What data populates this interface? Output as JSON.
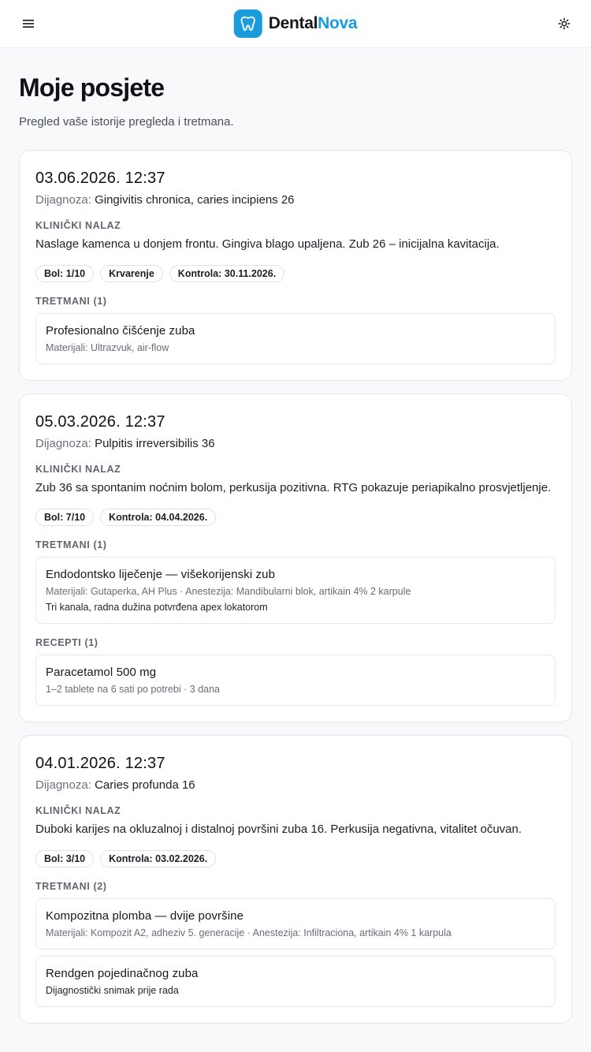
{
  "header": {
    "brand_part1": "Dental",
    "brand_part2": "Nova",
    "menu_icon": "menu-icon",
    "theme_icon": "sun-icon",
    "brand_color": "#1a9bdc"
  },
  "page": {
    "title": "Moje posjete",
    "subtitle": "Pregled vaše istorije pregleda i tretmana."
  },
  "labels": {
    "diagnosis": "Dijagnoza:",
    "finding": "KLINIČKI NALAZ"
  },
  "visits": [
    {
      "date": "03.06.2026. 12:37",
      "diagnosis": "Gingivitis chronica, caries incipiens 26",
      "finding": "Naslage kamenca u donjem frontu. Gingiva blago upaljena. Zub 26 – inicijalna kavitacija.",
      "badges": [
        "Bol: 1/10",
        "Krvarenje",
        "Kontrola: 30.11.2026."
      ],
      "treatments_label": "TRETMANI (1)",
      "treatments": [
        {
          "title": "Profesionalno čišćenje zuba",
          "meta": "Materijali: Ultrazvuk, air-flow",
          "note": ""
        }
      ]
    },
    {
      "date": "05.03.2026. 12:37",
      "diagnosis": "Pulpitis irreversibilis 36",
      "finding": "Zub 36 sa spontanim noćnim bolom, perkusija pozitivna. RTG pokazuje periapikalno prosvjetljenje.",
      "badges": [
        "Bol: 7/10",
        "Kontrola: 04.04.2026."
      ],
      "treatments_label": "TRETMANI (1)",
      "treatments": [
        {
          "title": "Endodontsko liječenje — višekorijenski zub",
          "meta": "Materijali: Gutaperka, AH Plus · Anestezija: Mandibularni blok, artikain 4% 2 karpule",
          "note": "Tri kanala, radna dužina potvrđena apex lokatorom"
        }
      ],
      "prescriptions_label": "RECEPTI (1)",
      "prescriptions": [
        {
          "title": "Paracetamol 500 mg",
          "meta": "1–2 tablete na 6 sati po potrebi · 3 dana"
        }
      ]
    },
    {
      "date": "04.01.2026. 12:37",
      "diagnosis": "Caries profunda 16",
      "finding": "Duboki karijes na okluzalnoj i distalnoj površini zuba 16. Perkusija negativna, vitalitet očuvan.",
      "badges": [
        "Bol: 3/10",
        "Kontrola: 03.02.2026."
      ],
      "treatments_label": "TRETMANI (2)",
      "treatments": [
        {
          "title": "Kompozitna plomba — dvije površine",
          "meta": "Materijali: Kompozit A2, adheziv 5. generacije · Anestezija: Infiltraciona, artikain 4% 1 karpula",
          "note": ""
        },
        {
          "title": "Rendgen pojedinačnog zuba",
          "meta": "",
          "note": "Dijagnostički snimak prije rada"
        }
      ]
    }
  ]
}
